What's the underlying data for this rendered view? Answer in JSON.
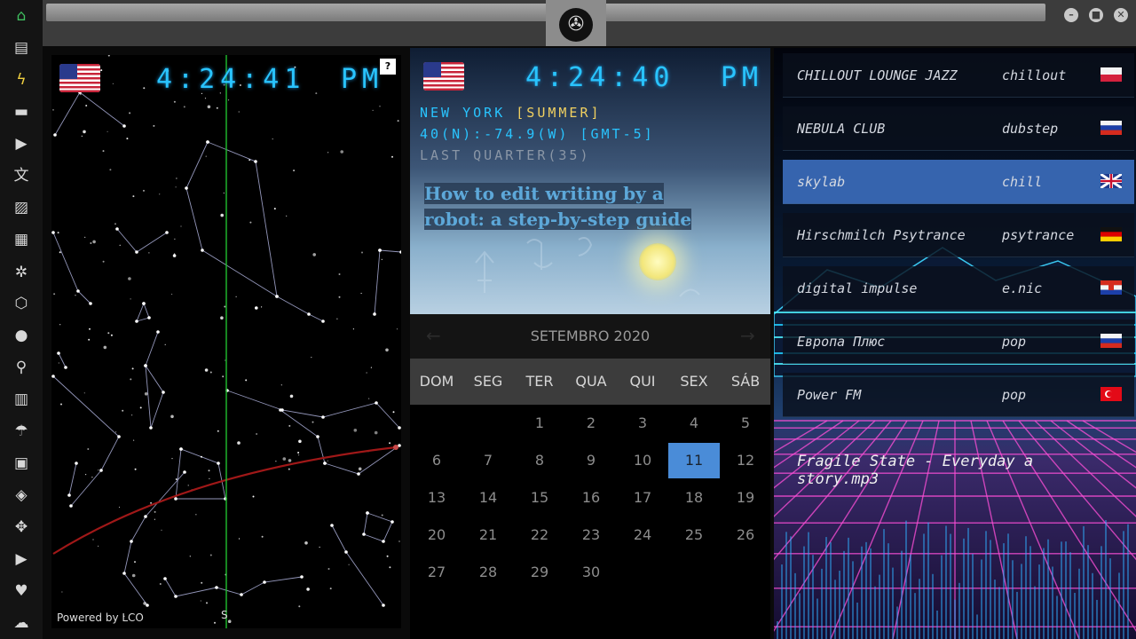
{
  "sidebar": {
    "items": [
      {
        "name": "home-icon",
        "glyph": "⌂"
      },
      {
        "name": "document-icon",
        "glyph": "▤"
      },
      {
        "name": "lightning-icon",
        "glyph": "ϟ"
      },
      {
        "name": "archive-icon",
        "glyph": "▬"
      },
      {
        "name": "play-icon",
        "glyph": "▶"
      },
      {
        "name": "translate-icon",
        "glyph": "文"
      },
      {
        "name": "image-icon",
        "glyph": "▨"
      },
      {
        "name": "newspaper-icon",
        "glyph": "▦"
      },
      {
        "name": "empire-icon",
        "glyph": "✲"
      },
      {
        "name": "hexagon-icon",
        "glyph": "⬡"
      },
      {
        "name": "globe-icon",
        "glyph": "●"
      },
      {
        "name": "search-icon",
        "glyph": "⚲"
      },
      {
        "name": "map-icon",
        "glyph": "▥"
      },
      {
        "name": "umbrella-icon",
        "glyph": "☂"
      },
      {
        "name": "contacts-icon",
        "glyph": "▣"
      },
      {
        "name": "code-icon",
        "glyph": "◈"
      },
      {
        "name": "expand-icon",
        "glyph": "✥"
      },
      {
        "name": "youtube-icon",
        "glyph": "▶"
      },
      {
        "name": "heart-icon",
        "glyph": "♥"
      },
      {
        "name": "cloud-icon",
        "glyph": "☁"
      }
    ]
  },
  "window": {
    "minimize": "–",
    "maximize": "■",
    "close": "✕",
    "logo": "✇"
  },
  "star_clock": {
    "time": "4:24:41",
    "ampm": "PM",
    "help": "?",
    "south_marker": "S",
    "powered_by": "Powered by LCO"
  },
  "sky_clock": {
    "time": "4:24:40",
    "ampm": "PM",
    "city": "NEW YORK",
    "season": "[SUMMER]",
    "coords": "40(N):-74.9(W) [GMT-5]",
    "moon": "LAST QUARTER(35)",
    "article": "How to edit writing by a robot: a step-by-step guide"
  },
  "calendar": {
    "month": "SETEMBRO 2020",
    "prev": "←",
    "next": "→",
    "weekdays": [
      "DOM",
      "SEG",
      "TER",
      "QUA",
      "QUI",
      "SEX",
      "SÁB"
    ],
    "days": [
      "1",
      "2",
      "3",
      "4",
      "5",
      "6",
      "7",
      "8",
      "9",
      "10",
      "11",
      "12",
      "13",
      "14",
      "15",
      "16",
      "17",
      "18",
      "19",
      "20",
      "21",
      "22",
      "23",
      "24",
      "25",
      "26",
      "27",
      "28",
      "29",
      "30"
    ],
    "first_weekday": 2,
    "selected": "11"
  },
  "radio": {
    "stations": [
      {
        "name": "CHILLOUT LOUNGE JAZZ",
        "genre": "chillout",
        "flag": "poland"
      },
      {
        "name": "NEBULA CLUB",
        "genre": "dubstep",
        "flag": "russia"
      },
      {
        "name": "skylab",
        "genre": "chill",
        "flag": "uk"
      },
      {
        "name": "Hirschmilch Psytrance",
        "genre": "psytrance",
        "flag": "germany"
      },
      {
        "name": "digital impulse",
        "genre": "e.nic",
        "flag": "croatia"
      },
      {
        "name": "Европа Плюс",
        "genre": "pop",
        "flag": "russia"
      },
      {
        "name": "Power FM",
        "genre": "pop",
        "flag": "turkey"
      }
    ],
    "selected_index": 2,
    "now_playing": "Fragile State - Everyday a story.mp3"
  },
  "colors": {
    "lcd": "#29c4ff",
    "season": "#f0d060",
    "accent": "#4a8cd8"
  }
}
